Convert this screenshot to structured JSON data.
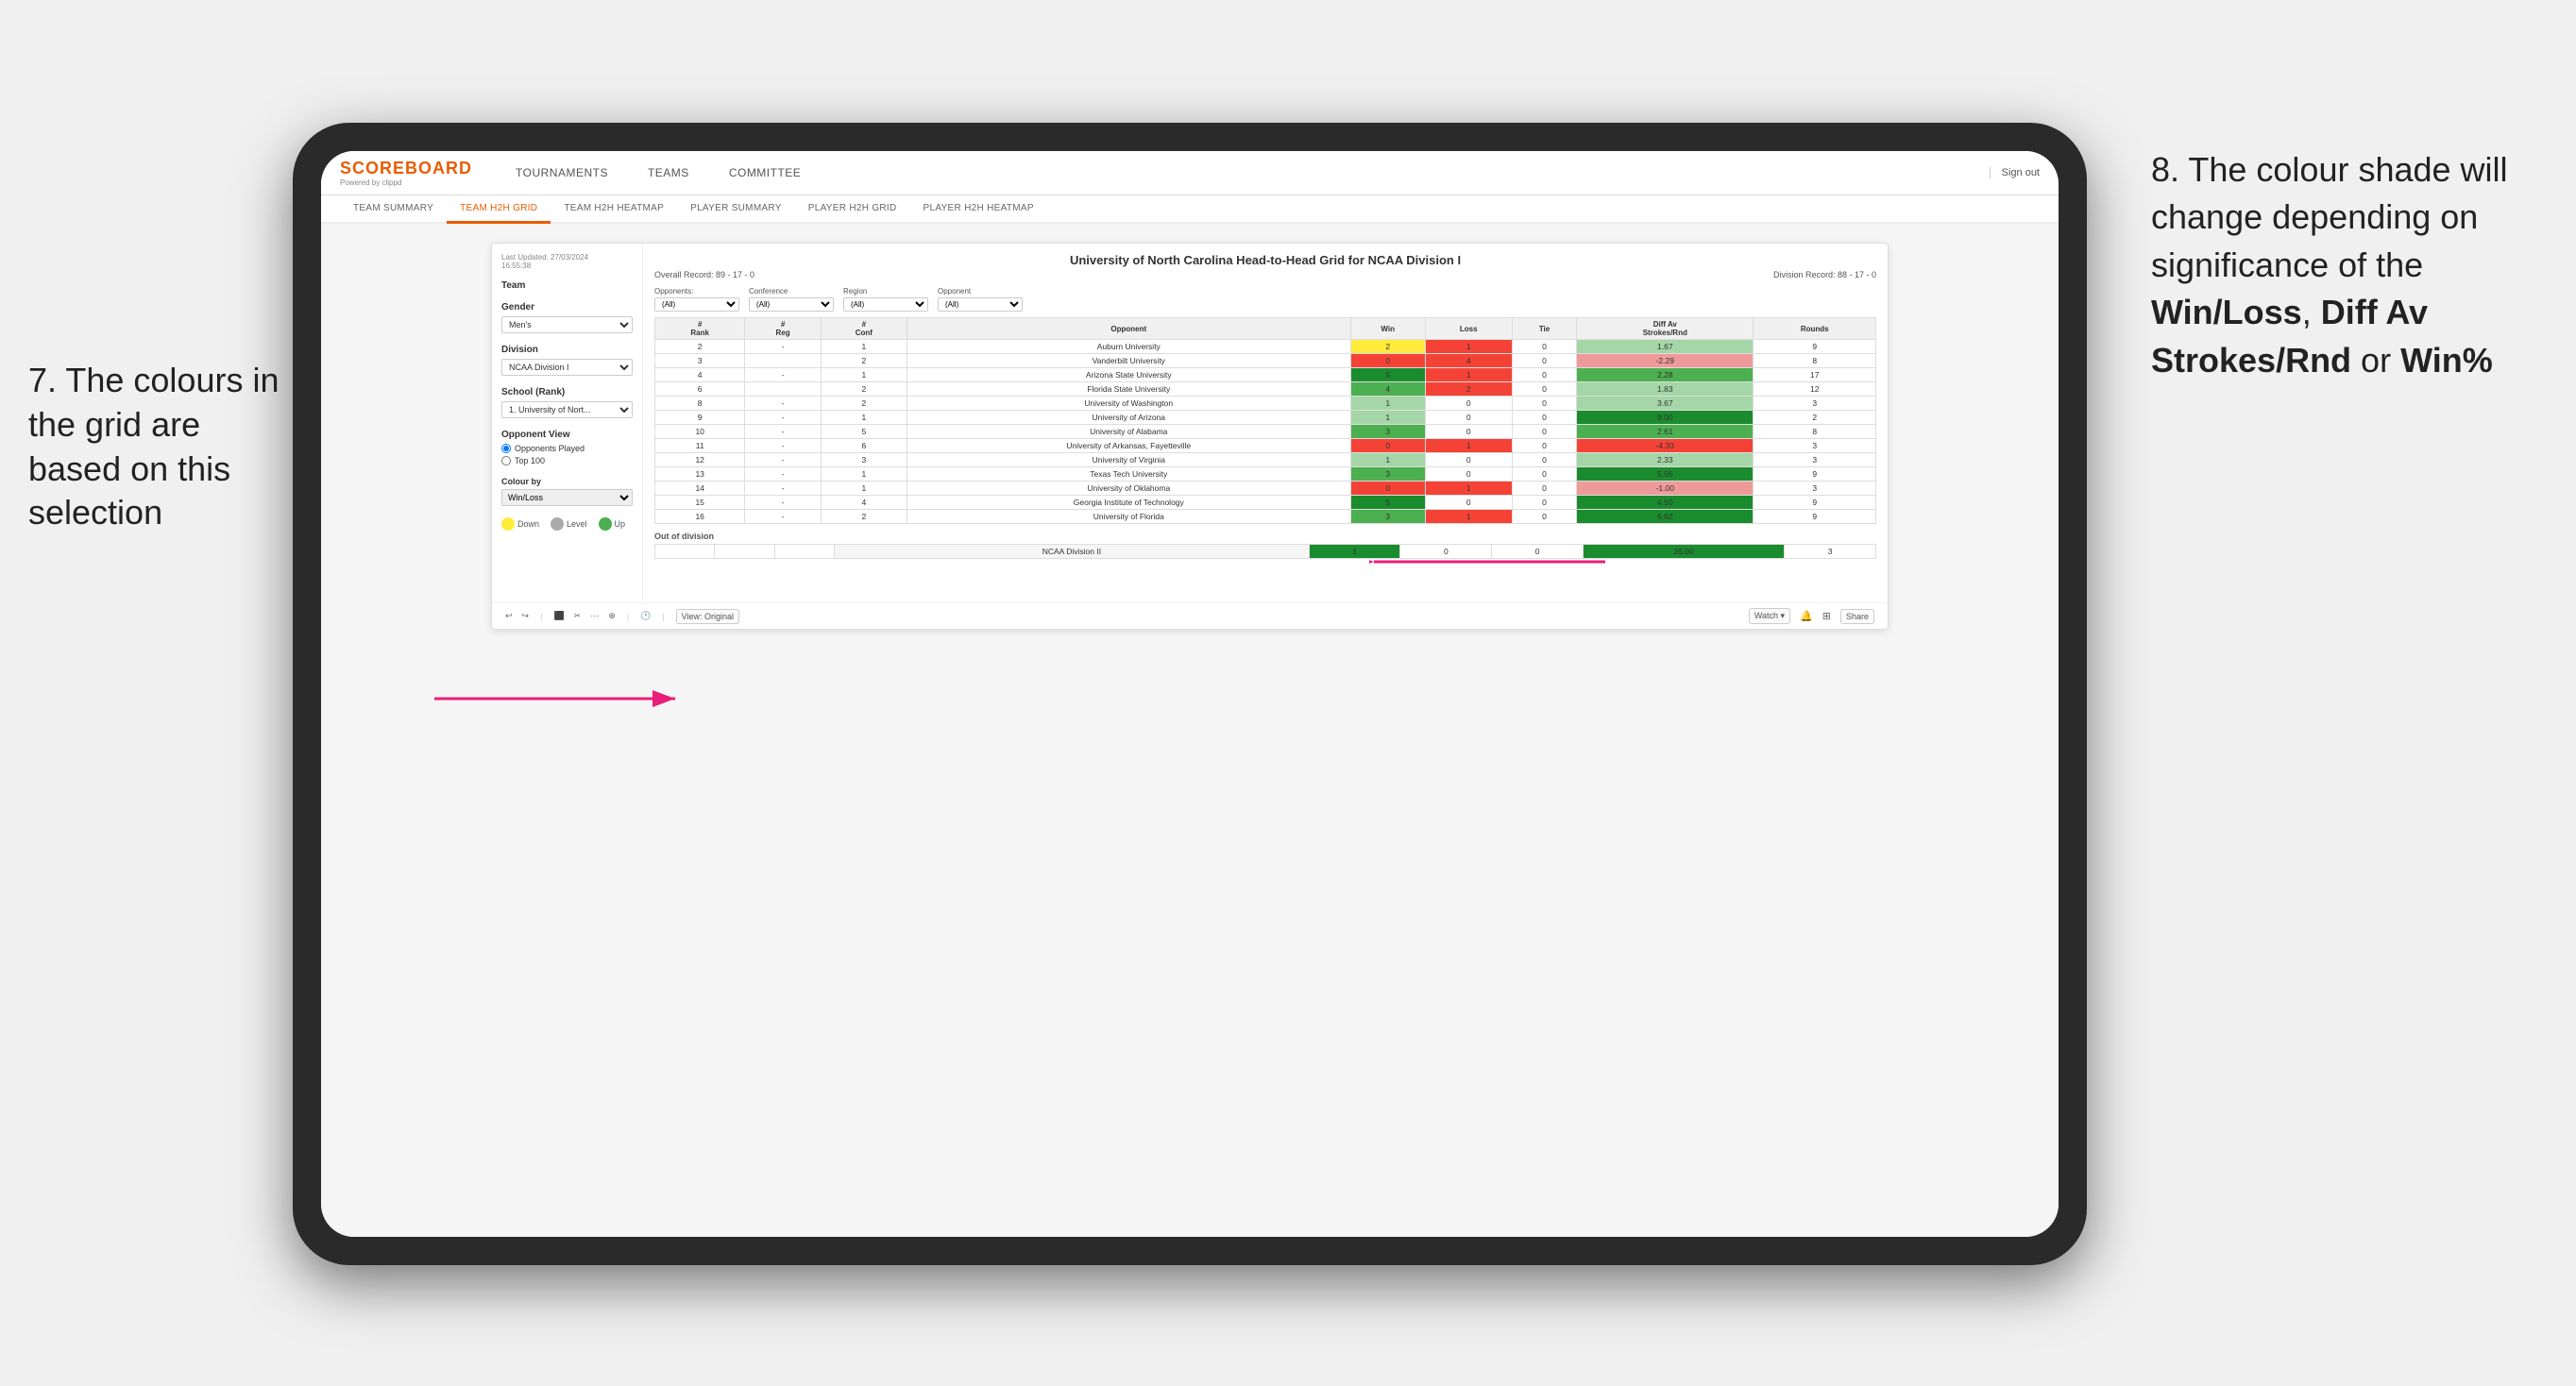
{
  "annotations": {
    "left": "7. The colours in the grid are based on this selection",
    "right_prefix": "8. The colour shade will change depending on significance of the ",
    "right_bold1": "Win/Loss",
    "right_sep1": ", ",
    "right_bold2": "Diff Av Strokes/Rnd",
    "right_sep2": " or ",
    "right_bold3": "Win%"
  },
  "header": {
    "logo": "SCOREBOARD",
    "logo_sub": "Powered by clippd",
    "nav": [
      "TOURNAMENTS",
      "TEAMS",
      "COMMITTEE"
    ],
    "sign_out": "Sign out"
  },
  "sub_nav": {
    "items": [
      "TEAM SUMMARY",
      "TEAM H2H GRID",
      "TEAM H2H HEATMAP",
      "PLAYER SUMMARY",
      "PLAYER H2H GRID",
      "PLAYER H2H HEATMAP"
    ],
    "active": "TEAM H2H GRID"
  },
  "sidebar": {
    "last_updated_label": "Last Updated: 27/03/2024",
    "last_updated_time": "16:55:38",
    "team_label": "Team",
    "gender_label": "Gender",
    "gender_value": "Men's",
    "division_label": "Division",
    "division_value": "NCAA Division I",
    "school_label": "School (Rank)",
    "school_value": "1. University of Nort...",
    "opponent_view_label": "Opponent View",
    "opponents_played": "Opponents Played",
    "top_100": "Top 100",
    "colour_by_label": "Colour by",
    "colour_by_value": "Win/Loss",
    "legend": {
      "down": "Down",
      "level": "Level",
      "up": "Up"
    }
  },
  "grid": {
    "title": "University of North Carolina Head-to-Head Grid for NCAA Division I",
    "overall_record": "Overall Record: 89 - 17 - 0",
    "division_record": "Division Record: 88 - 17 - 0",
    "filters": {
      "opponents_label": "Opponents:",
      "opponents_value": "(All)",
      "conference_label": "Conference",
      "conference_value": "(All)",
      "region_label": "Region",
      "region_value": "(All)",
      "opponent_label": "Opponent",
      "opponent_value": "(All)"
    },
    "columns": [
      "#\nRank",
      "#\nReg",
      "#\nConf",
      "Opponent",
      "Win",
      "Loss",
      "Tie",
      "Diff Av\nStrokes/Rnd",
      "Rounds"
    ],
    "rows": [
      {
        "rank": "2",
        "reg": "-",
        "conf": "1",
        "opponent": "Auburn University",
        "win": "2",
        "loss": "1",
        "tie": "0",
        "diff": "1.67",
        "rounds": "9",
        "win_color": "cell-yellow",
        "diff_color": "cell-green-light"
      },
      {
        "rank": "3",
        "reg": "",
        "conf": "2",
        "opponent": "Vanderbilt University",
        "win": "0",
        "loss": "4",
        "tie": "0",
        "diff": "-2.29",
        "rounds": "8",
        "win_color": "cell-red",
        "diff_color": "cell-red-light"
      },
      {
        "rank": "4",
        "reg": "-",
        "conf": "1",
        "opponent": "Arizona State University",
        "win": "5",
        "loss": "1",
        "tie": "0",
        "diff": "2.28",
        "rounds": "17",
        "win_color": "cell-green-dark",
        "diff_color": "cell-green-mid"
      },
      {
        "rank": "6",
        "reg": "",
        "conf": "2",
        "opponent": "Florida State University",
        "win": "4",
        "loss": "2",
        "tie": "0",
        "diff": "1.83",
        "rounds": "12",
        "win_color": "cell-green-mid",
        "diff_color": "cell-green-light"
      },
      {
        "rank": "8",
        "reg": "-",
        "conf": "2",
        "opponent": "University of Washington",
        "win": "1",
        "loss": "0",
        "tie": "0",
        "diff": "3.67",
        "rounds": "3",
        "win_color": "cell-green-light",
        "diff_color": "cell-green-light"
      },
      {
        "rank": "9",
        "reg": "-",
        "conf": "1",
        "opponent": "University of Arizona",
        "win": "1",
        "loss": "0",
        "tie": "0",
        "diff": "9.00",
        "rounds": "2",
        "win_color": "cell-green-light",
        "diff_color": "cell-green-dark"
      },
      {
        "rank": "10",
        "reg": "-",
        "conf": "5",
        "opponent": "University of Alabama",
        "win": "3",
        "loss": "0",
        "tie": "0",
        "diff": "2.61",
        "rounds": "8",
        "win_color": "cell-green-mid",
        "diff_color": "cell-green-mid"
      },
      {
        "rank": "11",
        "reg": "-",
        "conf": "6",
        "opponent": "University of Arkansas, Fayetteville",
        "win": "0",
        "loss": "1",
        "tie": "0",
        "diff": "-4.33",
        "rounds": "3",
        "win_color": "cell-red",
        "diff_color": "cell-red"
      },
      {
        "rank": "12",
        "reg": "-",
        "conf": "3",
        "opponent": "University of Virginia",
        "win": "1",
        "loss": "0",
        "tie": "0",
        "diff": "2.33",
        "rounds": "3",
        "win_color": "cell-green-light",
        "diff_color": "cell-green-light"
      },
      {
        "rank": "13",
        "reg": "-",
        "conf": "1",
        "opponent": "Texas Tech University",
        "win": "3",
        "loss": "0",
        "tie": "0",
        "diff": "5.56",
        "rounds": "9",
        "win_color": "cell-green-mid",
        "diff_color": "cell-green-dark"
      },
      {
        "rank": "14",
        "reg": "-",
        "conf": "1",
        "opponent": "University of Oklahoma",
        "win": "0",
        "loss": "1",
        "tie": "0",
        "diff": "-1.00",
        "rounds": "3",
        "win_color": "cell-red",
        "diff_color": "cell-red-light"
      },
      {
        "rank": "15",
        "reg": "-",
        "conf": "4",
        "opponent": "Georgia Institute of Technology",
        "win": "5",
        "loss": "0",
        "tie": "0",
        "diff": "4.50",
        "rounds": "9",
        "win_color": "cell-green-dark",
        "diff_color": "cell-green-dark"
      },
      {
        "rank": "16",
        "reg": "-",
        "conf": "2",
        "opponent": "University of Florida",
        "win": "3",
        "loss": "1",
        "tie": "0",
        "diff": "6.62",
        "rounds": "9",
        "win_color": "cell-green-mid",
        "diff_color": "cell-green-dark"
      }
    ],
    "out_of_division_label": "Out of division",
    "out_of_division_row": {
      "division": "NCAA Division II",
      "win": "1",
      "loss": "0",
      "tie": "0",
      "diff": "26.00",
      "rounds": "3",
      "win_color": "cell-green-dark",
      "diff_color": "cell-green-dark"
    }
  },
  "toolbar": {
    "view_label": "View: Original",
    "watch_label": "Watch ▾",
    "share_label": "Share"
  }
}
